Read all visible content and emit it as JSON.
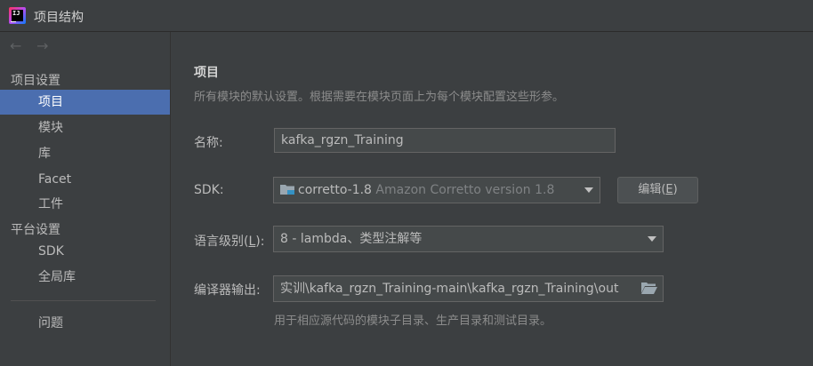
{
  "window": {
    "title": "项目结构"
  },
  "nav": {
    "back": "←",
    "forward": "→"
  },
  "sidebar": {
    "project_settings_header": "项目设置",
    "project_settings_items": [
      {
        "label": "项目",
        "selected": true
      },
      {
        "label": "模块"
      },
      {
        "label": "库"
      },
      {
        "label": "Facet"
      },
      {
        "label": "工件"
      }
    ],
    "platform_settings_header": "平台设置",
    "platform_settings_items": [
      {
        "label": "SDK"
      },
      {
        "label": "全局库"
      }
    ],
    "problems_label": "问题"
  },
  "main": {
    "title": "项目",
    "description": "所有模块的默认设置。根据需要在模块页面上为每个模块配置这些形参。",
    "name_label": "名称:",
    "name_value": "kafka_rgzn_Training",
    "sdk_label": "SDK:",
    "sdk_value": "corretto-1.8",
    "sdk_detail": "Amazon Corretto version 1.8",
    "edit_button_text": "编辑(",
    "edit_button_mnemonic": "E",
    "edit_button_suffix": ")",
    "language_level_label_prefix": "语言级别(",
    "language_level_mnemonic": "L",
    "language_level_label_suffix": "):",
    "language_level_value": "8 - lambda、类型注解等",
    "compiler_output_label": "编译器输出:",
    "compiler_output_value": "实训\\kafka_rgzn_Training-main\\kafka_rgzn_Training\\out",
    "compiler_output_hint": "用于相应源代码的模块子目录、生产目录和测试目录。"
  },
  "colors": {
    "background": "#3c3f41",
    "selection": "#4b6eaf",
    "input_background": "#45494a",
    "folder_icon": "#9aa7b0",
    "sdk_folder_icon": "#3592c4"
  },
  "icons": [
    "ide-app-icon",
    "back-arrow-icon",
    "forward-arrow-icon",
    "sdk-folder-icon",
    "dropdown-arrow-icon",
    "folder-browse-icon"
  ]
}
